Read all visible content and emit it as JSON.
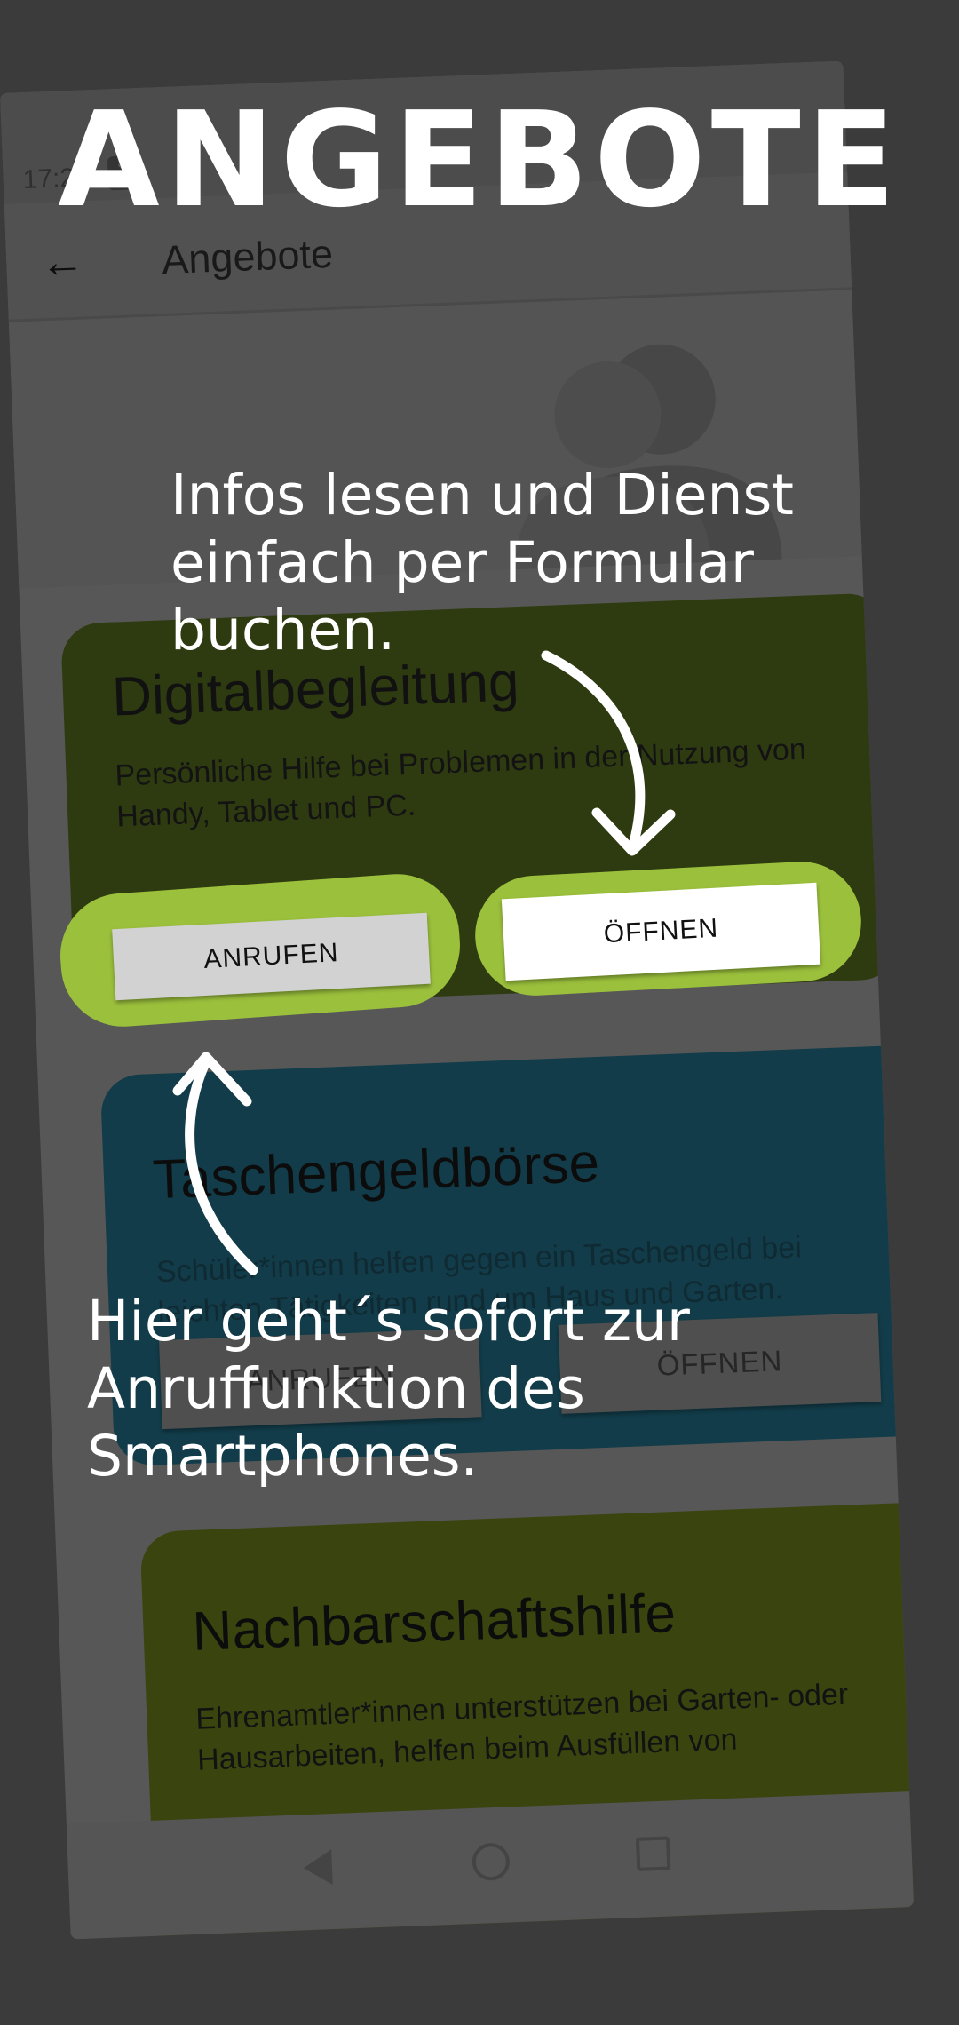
{
  "statusbar": {
    "time": "17:27",
    "sigma": "Σ"
  },
  "appbar": {
    "back_icon": "←",
    "title": "Angebote"
  },
  "cards": [
    {
      "title": "Digitalbegleitung",
      "description": "Persönliche Hilfe bei Problemen in der Nutzung von Handy, Tablet und PC.",
      "call_label": "ANRUFEN",
      "open_label": "ÖFFNEN",
      "color": "#2e3a10"
    },
    {
      "title": "Taschengeldbörse",
      "description": "Schüler*innen helfen gegen ein Taschengeld bei leichten Tätigkeiten rund um Haus und Garten.",
      "call_label": "ANRUFEN",
      "open_label": "ÖFFNEN",
      "color": "#123c49"
    },
    {
      "title": "Nachbarschaftshilfe",
      "description": "Ehrenamtler*innen unterstützen bei Garten- oder Hausarbeiten, helfen beim Ausfüllen von",
      "color": "#3a440f"
    }
  ],
  "overlay": {
    "headline": "ANGEBOTE",
    "note_top": "Infos lesen und Dienst\neinfach per Formular\nbuchen.",
    "note_bottom": "Hier geht´s sofort zur\nAnruffunktion des\nSmartphones."
  },
  "icons": [
    "back-arrow-icon",
    "people-icon",
    "nav-back-icon",
    "nav-home-icon",
    "nav-recents-icon",
    "arrow-down-icon",
    "arrow-up-icon"
  ],
  "colors": {
    "highlight": "#9bc03c",
    "background": "#3b3b3b",
    "annotation": "#ffffff"
  }
}
